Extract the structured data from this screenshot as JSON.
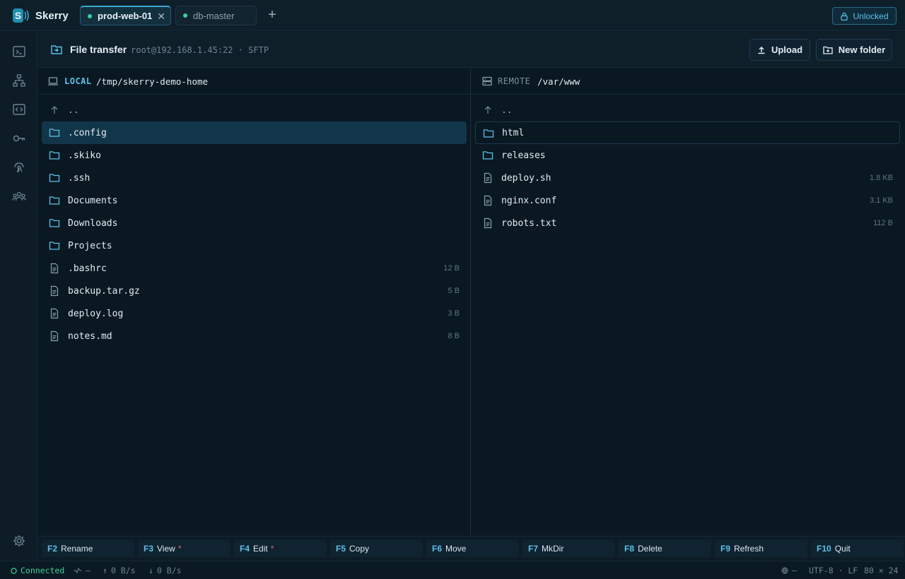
{
  "app": {
    "name": "Skerry"
  },
  "tabs": [
    {
      "label": "prod-web-01",
      "active": true
    },
    {
      "label": "db-master",
      "active": false
    }
  ],
  "lock": {
    "label": "Unlocked"
  },
  "header": {
    "title": "File transfer",
    "connection": "root@192.168.1.45:22 · SFTP",
    "upload_label": "Upload",
    "new_folder_label": "New folder"
  },
  "local": {
    "label": "LOCAL",
    "path": "/tmp/skerry-demo-home",
    "parent": "..",
    "entries": [
      {
        "name": ".config",
        "type": "folder",
        "size": ""
      },
      {
        "name": ".skiko",
        "type": "folder",
        "size": ""
      },
      {
        "name": ".ssh",
        "type": "folder",
        "size": ""
      },
      {
        "name": "Documents",
        "type": "folder",
        "size": ""
      },
      {
        "name": "Downloads",
        "type": "folder",
        "size": ""
      },
      {
        "name": "Projects",
        "type": "folder",
        "size": ""
      },
      {
        "name": ".bashrc",
        "type": "file",
        "size": "12 B"
      },
      {
        "name": "backup.tar.gz",
        "type": "file",
        "size": "5 B"
      },
      {
        "name": "deploy.log",
        "type": "file",
        "size": "3 B"
      },
      {
        "name": "notes.md",
        "type": "file",
        "size": "8 B"
      }
    ]
  },
  "remote": {
    "label": "REMOTE",
    "path": "/var/www",
    "parent": "..",
    "entries": [
      {
        "name": "html",
        "type": "folder",
        "size": ""
      },
      {
        "name": "releases",
        "type": "folder",
        "size": ""
      },
      {
        "name": "deploy.sh",
        "type": "file",
        "size": "1.8 KB"
      },
      {
        "name": "nginx.conf",
        "type": "file",
        "size": "3.1 KB"
      },
      {
        "name": "robots.txt",
        "type": "file",
        "size": "112 B"
      }
    ]
  },
  "fkeys": [
    {
      "key": "F2",
      "label": "Rename",
      "star": ""
    },
    {
      "key": "F3",
      "label": "View",
      "star": "*"
    },
    {
      "key": "F4",
      "label": "Edit",
      "star": "*"
    },
    {
      "key": "F5",
      "label": "Copy",
      "star": ""
    },
    {
      "key": "F6",
      "label": "Move",
      "star": ""
    },
    {
      "key": "F7",
      "label": "MkDir",
      "star": ""
    },
    {
      "key": "F8",
      "label": "Delete",
      "star": ""
    },
    {
      "key": "F9",
      "label": "Refresh",
      "star": ""
    },
    {
      "key": "F10",
      "label": "Quit",
      "star": ""
    }
  ],
  "status": {
    "connection": "Connected",
    "latency": "—",
    "upload_rate": "0 B/s",
    "download_rate": "0 B/s",
    "globe": "—",
    "encoding": "UTF-8 · LF",
    "size": "80 × 24"
  },
  "icons": {
    "rail": [
      "terminal-icon",
      "sitemap-icon",
      "code-icon",
      "key-icon",
      "fingerprint-icon",
      "team-icon"
    ],
    "settings": "gear-icon"
  },
  "colors": {
    "accent": "#5cc1e8",
    "connected": "#3ccf9a",
    "selected": "#123649",
    "warn": "#e0605a"
  }
}
